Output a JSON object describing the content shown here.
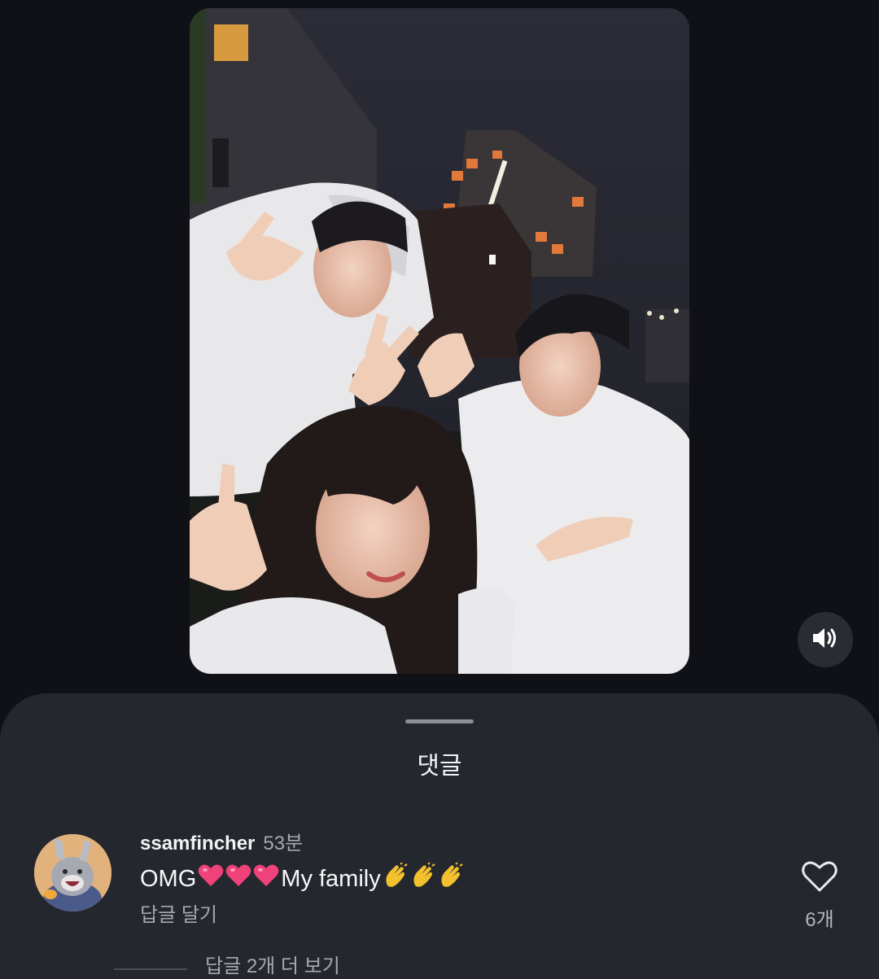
{
  "media": {
    "type": "photo",
    "sound_icon": "speaker-on-icon"
  },
  "comments_sheet": {
    "title": "댓글",
    "comments": [
      {
        "username": "ssamfincher",
        "time": "53분",
        "text_before": "OMG",
        "emoji_hearts": [
          "heart-emoji",
          "heart-emoji",
          "heart-emoji"
        ],
        "text_after": "My family",
        "emoji_claps": [
          "clap-emoji",
          "clap-emoji",
          "clap-emoji"
        ],
        "reply_label": "답글 달기",
        "like_count": "6개",
        "view_more_replies": "답글 2개 더 보기"
      }
    ]
  },
  "colors": {
    "background": "#0f1116",
    "sheet": "#25272e",
    "primary_text": "#f2f3f5",
    "secondary_text": "#a6a9b0",
    "heart": "#f0427a",
    "clap": "#f3c12e"
  }
}
